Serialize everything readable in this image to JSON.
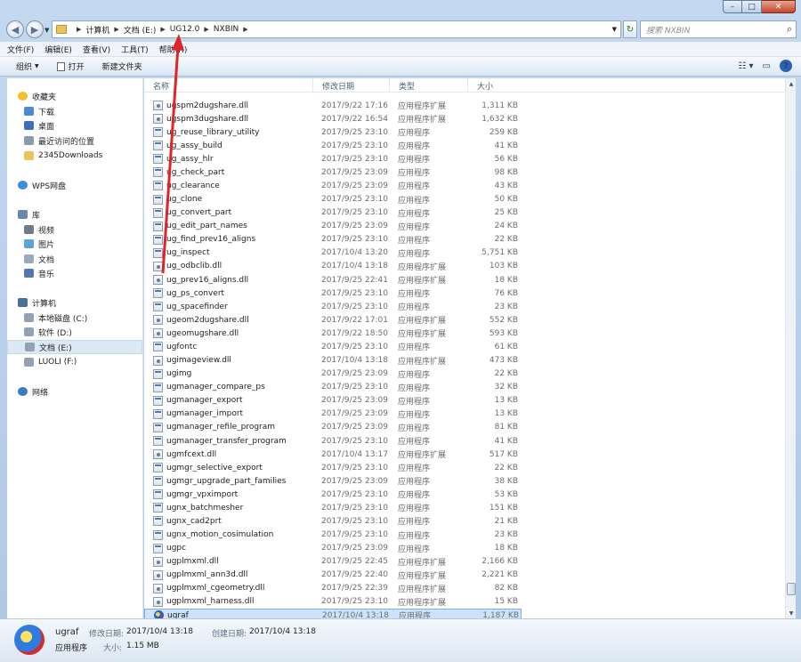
{
  "window": {
    "caption_min": "–",
    "caption_max": "□",
    "caption_close": "✕"
  },
  "address": {
    "crumbs": [
      "计算机",
      "文档 (E:)",
      "UG12.0",
      "NXBIN"
    ],
    "search_placeholder": "搜索 NXBIN"
  },
  "menu": [
    "文件(F)",
    "编辑(E)",
    "查看(V)",
    "工具(T)",
    "帮助(H)"
  ],
  "commands": {
    "organize": "组织",
    "open": "打开",
    "new_folder": "新建文件夹"
  },
  "sidebar": [
    {
      "label": "收藏夹",
      "icon": "star-icon",
      "group": true
    },
    {
      "label": "下载",
      "icon": "download-folder-icon"
    },
    {
      "label": "桌面",
      "icon": "desktop-icon"
    },
    {
      "label": "最近访问的位置",
      "icon": "recent-places-icon"
    },
    {
      "label": "2345Downloads",
      "icon": "folder-icon"
    },
    {
      "label": "WPS网盘",
      "icon": "cloud-icon",
      "group": true
    },
    {
      "label": "库",
      "icon": "library-icon",
      "group": true
    },
    {
      "label": "视频",
      "icon": "video-icon"
    },
    {
      "label": "图片",
      "icon": "picture-icon"
    },
    {
      "label": "文档",
      "icon": "document-icon"
    },
    {
      "label": "音乐",
      "icon": "music-icon"
    },
    {
      "label": "计算机",
      "icon": "computer-icon",
      "group": true
    },
    {
      "label": "本地磁盘 (C:)",
      "icon": "drive-icon"
    },
    {
      "label": "软件 (D:)",
      "icon": "drive-icon"
    },
    {
      "label": "文档 (E:)",
      "icon": "drive-icon",
      "selected": true
    },
    {
      "label": "LUOLI (F:)",
      "icon": "drive-icon"
    },
    {
      "label": "网络",
      "icon": "network-icon",
      "group": true
    }
  ],
  "columns": {
    "name": "名称",
    "date": "修改日期",
    "type": "类型",
    "size": "大小"
  },
  "files": [
    {
      "name": "ugspm2dugshare.dll",
      "date": "2017/9/22 17:16",
      "type": "应用程序扩展",
      "size": "1,311 KB",
      "kind": "dll"
    },
    {
      "name": "ugspm3dugshare.dll",
      "date": "2017/9/22 16:54",
      "type": "应用程序扩展",
      "size": "1,632 KB",
      "kind": "dll"
    },
    {
      "name": "ug_reuse_library_utility",
      "date": "2017/9/25 23:10",
      "type": "应用程序",
      "size": "259 KB",
      "kind": "exe"
    },
    {
      "name": "ug_assy_build",
      "date": "2017/9/25 23:10",
      "type": "应用程序",
      "size": "41 KB",
      "kind": "exe"
    },
    {
      "name": "ug_assy_hlr",
      "date": "2017/9/25 23:10",
      "type": "应用程序",
      "size": "56 KB",
      "kind": "exe"
    },
    {
      "name": "ug_check_part",
      "date": "2017/9/25 23:09",
      "type": "应用程序",
      "size": "98 KB",
      "kind": "exe"
    },
    {
      "name": "ug_clearance",
      "date": "2017/9/25 23:09",
      "type": "应用程序",
      "size": "43 KB",
      "kind": "exe"
    },
    {
      "name": "ug_clone",
      "date": "2017/9/25 23:10",
      "type": "应用程序",
      "size": "50 KB",
      "kind": "exe"
    },
    {
      "name": "ug_convert_part",
      "date": "2017/9/25 23:10",
      "type": "应用程序",
      "size": "25 KB",
      "kind": "exe"
    },
    {
      "name": "ug_edit_part_names",
      "date": "2017/9/25 23:09",
      "type": "应用程序",
      "size": "24 KB",
      "kind": "exe"
    },
    {
      "name": "ug_find_prev16_aligns",
      "date": "2017/9/25 23:10",
      "type": "应用程序",
      "size": "22 KB",
      "kind": "exe"
    },
    {
      "name": "ug_inspect",
      "date": "2017/10/4 13:20",
      "type": "应用程序",
      "size": "5,751 KB",
      "kind": "exe"
    },
    {
      "name": "ug_odbclib.dll",
      "date": "2017/10/4 13:18",
      "type": "应用程序扩展",
      "size": "103 KB",
      "kind": "dll"
    },
    {
      "name": "ug_prev16_aligns.dll",
      "date": "2017/9/25 22:41",
      "type": "应用程序扩展",
      "size": "18 KB",
      "kind": "dll"
    },
    {
      "name": "ug_ps_convert",
      "date": "2017/9/25 23:10",
      "type": "应用程序",
      "size": "76 KB",
      "kind": "exe"
    },
    {
      "name": "ug_spacefinder",
      "date": "2017/9/25 23:10",
      "type": "应用程序",
      "size": "23 KB",
      "kind": "exe"
    },
    {
      "name": "ugeom2dugshare.dll",
      "date": "2017/9/22 17:01",
      "type": "应用程序扩展",
      "size": "552 KB",
      "kind": "dll"
    },
    {
      "name": "ugeomugshare.dll",
      "date": "2017/9/22 18:50",
      "type": "应用程序扩展",
      "size": "593 KB",
      "kind": "dll"
    },
    {
      "name": "ugfontc",
      "date": "2017/9/25 23:10",
      "type": "应用程序",
      "size": "61 KB",
      "kind": "exe"
    },
    {
      "name": "ugimageview.dll",
      "date": "2017/10/4 13:18",
      "type": "应用程序扩展",
      "size": "473 KB",
      "kind": "dll"
    },
    {
      "name": "ugimg",
      "date": "2017/9/25 23:09",
      "type": "应用程序",
      "size": "22 KB",
      "kind": "exe"
    },
    {
      "name": "ugmanager_compare_ps",
      "date": "2017/9/25 23:10",
      "type": "应用程序",
      "size": "32 KB",
      "kind": "exe"
    },
    {
      "name": "ugmanager_export",
      "date": "2017/9/25 23:09",
      "type": "应用程序",
      "size": "13 KB",
      "kind": "exe"
    },
    {
      "name": "ugmanager_import",
      "date": "2017/9/25 23:09",
      "type": "应用程序",
      "size": "13 KB",
      "kind": "exe"
    },
    {
      "name": "ugmanager_refile_program",
      "date": "2017/9/25 23:09",
      "type": "应用程序",
      "size": "81 KB",
      "kind": "exe"
    },
    {
      "name": "ugmanager_transfer_program",
      "date": "2017/9/25 23:10",
      "type": "应用程序",
      "size": "41 KB",
      "kind": "exe"
    },
    {
      "name": "ugmfcext.dll",
      "date": "2017/10/4 13:17",
      "type": "应用程序扩展",
      "size": "517 KB",
      "kind": "dll"
    },
    {
      "name": "ugmgr_selective_export",
      "date": "2017/9/25 23:10",
      "type": "应用程序",
      "size": "22 KB",
      "kind": "exe"
    },
    {
      "name": "ugmgr_upgrade_part_families",
      "date": "2017/9/25 23:09",
      "type": "应用程序",
      "size": "38 KB",
      "kind": "exe"
    },
    {
      "name": "ugmgr_vpximport",
      "date": "2017/9/25 23:10",
      "type": "应用程序",
      "size": "53 KB",
      "kind": "exe"
    },
    {
      "name": "ugnx_batchmesher",
      "date": "2017/9/25 23:10",
      "type": "应用程序",
      "size": "151 KB",
      "kind": "exe"
    },
    {
      "name": "ugnx_cad2prt",
      "date": "2017/9/25 23:10",
      "type": "应用程序",
      "size": "21 KB",
      "kind": "exe"
    },
    {
      "name": "ugnx_motion_cosimulation",
      "date": "2017/9/25 23:10",
      "type": "应用程序",
      "size": "23 KB",
      "kind": "exe"
    },
    {
      "name": "ugpc",
      "date": "2017/9/25 23:09",
      "type": "应用程序",
      "size": "18 KB",
      "kind": "exe"
    },
    {
      "name": "ugplmxml.dll",
      "date": "2017/9/25 22:45",
      "type": "应用程序扩展",
      "size": "2,166 KB",
      "kind": "dll"
    },
    {
      "name": "ugplmxml_ann3d.dll",
      "date": "2017/9/25 22:40",
      "type": "应用程序扩展",
      "size": "2,221 KB",
      "kind": "dll"
    },
    {
      "name": "ugplmxml_cgeometry.dll",
      "date": "2017/9/25 22:39",
      "type": "应用程序扩展",
      "size": "82 KB",
      "kind": "dll"
    },
    {
      "name": "ugplmxml_harness.dll",
      "date": "2017/9/25 23:10",
      "type": "应用程序扩展",
      "size": "15 KB",
      "kind": "dll"
    },
    {
      "name": "ugraf",
      "date": "2017/10/4 13:18",
      "type": "应用程序",
      "size": "1,187 KB",
      "kind": "ugraf",
      "selected": true
    }
  ],
  "details": {
    "name": "ugraf",
    "type": "应用程序",
    "modified_label": "修改日期:",
    "modified": "2017/10/4 13:18",
    "created_label": "创建日期:",
    "created": "2017/10/4 13:18",
    "size_label": "大小:",
    "size": "1.15 MB"
  },
  "colors": {
    "annotation_arrow": "#e0242a",
    "selection": "#cde3fb"
  }
}
